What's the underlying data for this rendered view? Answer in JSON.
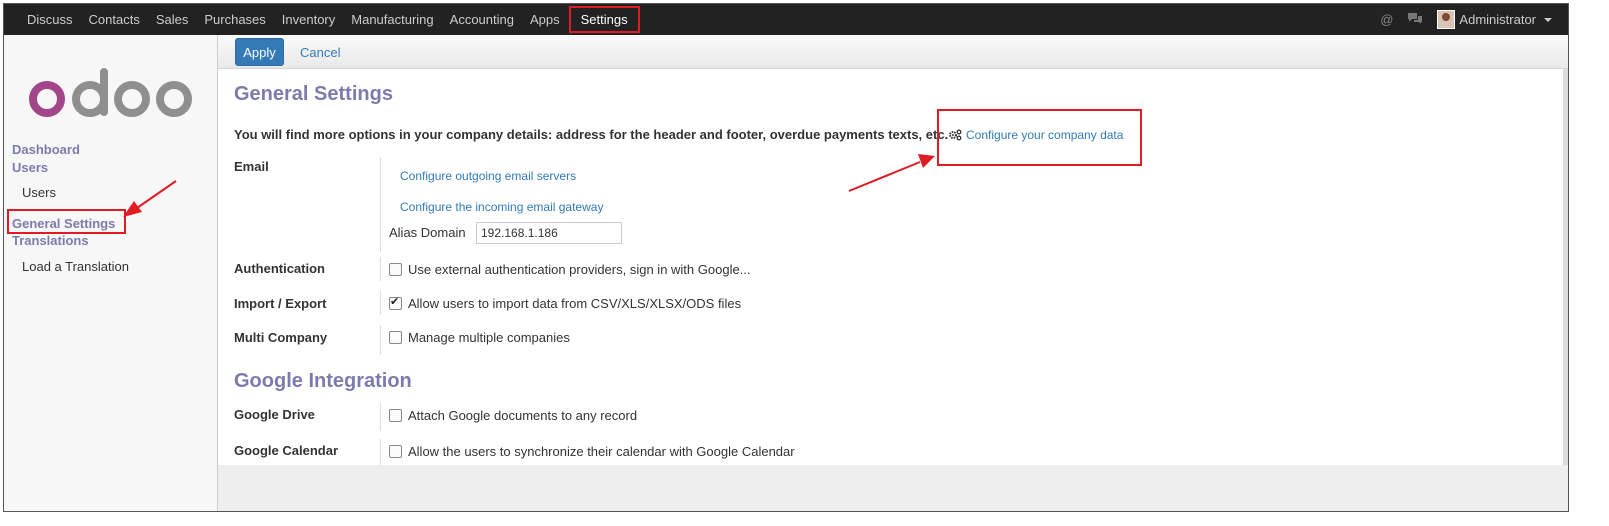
{
  "topbar": {
    "nav": [
      "Discuss",
      "Contacts",
      "Sales",
      "Purchases",
      "Inventory",
      "Manufacturing",
      "Accounting",
      "Apps"
    ],
    "active": "Settings",
    "user": "Administrator",
    "icons": [
      "at-icon",
      "chat-icon"
    ]
  },
  "sidebar": {
    "logo": "odoo",
    "dashboard": "Dashboard",
    "users_head": "Users",
    "users_item": "Users",
    "general_settings": "General Settings",
    "translations": "Translations",
    "load_translation": "Load a Translation"
  },
  "control": {
    "apply": "Apply",
    "cancel": "Cancel"
  },
  "general": {
    "title": "General Settings",
    "note": "You will find more options in your company details: address for the header and footer, overdue payments texts, etc.",
    "configure_company": "Configure your company data",
    "email_label": "Email",
    "outgoing": "Configure outgoing email servers",
    "incoming": "Configure the incoming email gateway",
    "alias_label": "Alias Domain",
    "alias_value": "192.168.1.186",
    "auth_label": "Authentication",
    "auth_text": "Use external authentication providers, sign in with Google...",
    "auth_checked": false,
    "import_label": "Import / Export",
    "import_text": "Allow users to import data from CSV/XLS/XLSX/ODS files",
    "import_checked": true,
    "multi_label": "Multi Company",
    "multi_text": "Manage multiple companies",
    "multi_checked": false
  },
  "google": {
    "title": "Google Integration",
    "drive_label": "Google Drive",
    "drive_text": "Attach Google documents to any record",
    "drive_checked": false,
    "calendar_label": "Google Calendar",
    "calendar_text": "Allow the users to synchronize their calendar with Google Calendar",
    "calendar_checked": false
  },
  "colors": {
    "accent": "#7c7bad",
    "link": "#337ab7",
    "highlight": "#e01b24",
    "topbar": "#222222"
  }
}
